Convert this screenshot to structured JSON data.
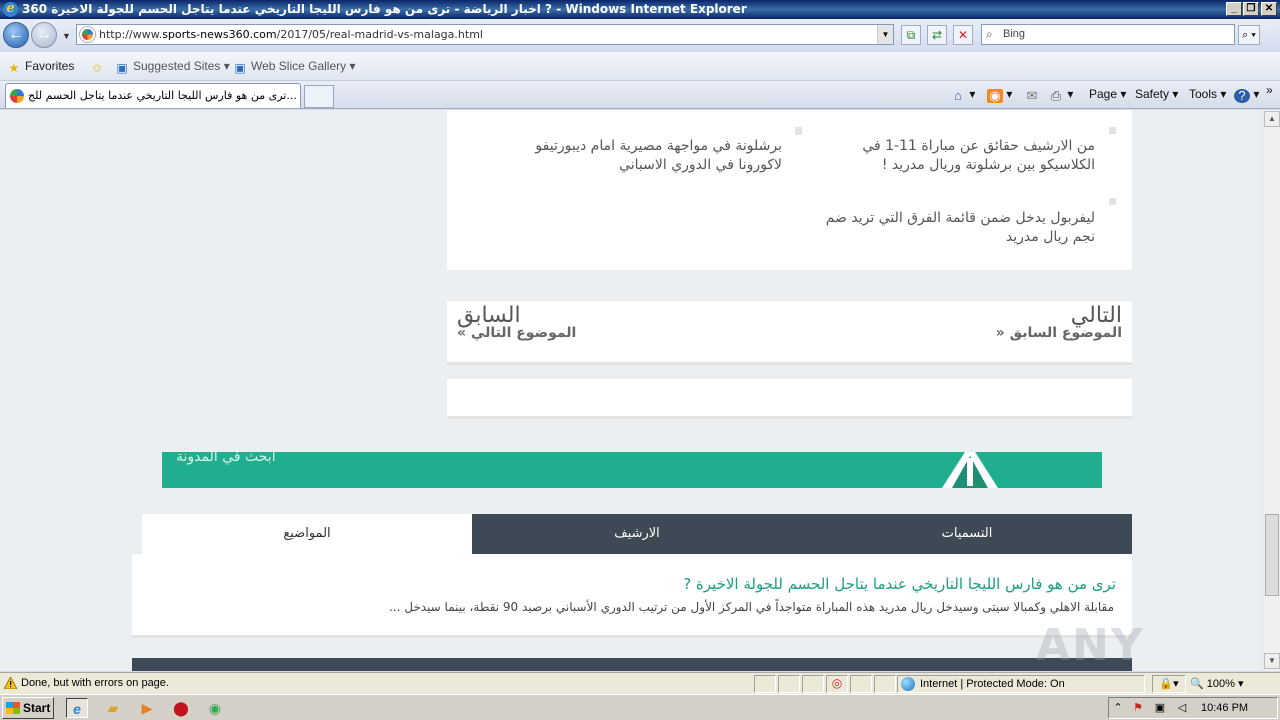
{
  "window": {
    "title": "360 اخبار الرياضة - ترى من هو فارس الليجا التاريخي عندما يتاجل الحسم للجولة الاخيرة ? - Windows Internet Explorer",
    "min": "_",
    "restore": "❐",
    "close": "✕"
  },
  "address": {
    "url_prefix": "http://www.",
    "url_host": "sports-news360.com",
    "url_path": "/2017/05/real-madrid-vs-malaga.html",
    "search_placeholder": "Bing"
  },
  "favorites": {
    "favorites_label": "Favorites",
    "suggested_sites": "Suggested Sites",
    "web_slice_gallery": "Web Slice Gallery"
  },
  "tabs": {
    "active_tab_label": "ترى من هو فارس الليجا التاريخي عندما يتاجل الحسم للج..."
  },
  "commands": {
    "page": "Page",
    "safety": "Safety",
    "tools": "Tools"
  },
  "related": {
    "item1_line1": "من الارشيف  حقائق عن مباراة 11-1 في",
    "item1_line2": "الكلاسيكو بين برشلونة وريال مدريد !",
    "item2_line1": "برشلونة في مواجهة مصيرية امام ديبورتيفو",
    "item2_line2": "لاكورونا في الدوري الاسباني",
    "item3_line1": "ليفربول يدخل ضمن قائمة الفرق التي تريد ضم",
    "item3_line2": "نجم ريال مدريد"
  },
  "prevnext": {
    "next_title": "التالي",
    "next_sub": "الموضوع السابق «",
    "prev_title": "السابق",
    "prev_sub": "الموضوع التالي »"
  },
  "search_blog": {
    "label": "ابحث في المدونة"
  },
  "sidebar_tabs": {
    "labels": "التسميات",
    "archive": "الارشيف",
    "topics": "المواضيع"
  },
  "post": {
    "title": "ترى من هو فارس الليجا التاريخي عندما يتاجل الحسم للجولة الاخيرة ?",
    "excerpt": "مقابلة الاهلي وكمبالا سيتى وسيدخل ريال مدريد هذه المباراة متواجداً في المركز الأول من ترتيب الدوري الأسباني برصيد 90 نقطة، بينما سيدخل ..."
  },
  "watermark": {
    "text": "ANY RUN"
  },
  "status": {
    "message": "Done, but with errors on page.",
    "zone": "Internet | Protected Mode: On",
    "zoom": "100%"
  },
  "taskbar": {
    "start": "Start",
    "time": "10:46 PM"
  }
}
